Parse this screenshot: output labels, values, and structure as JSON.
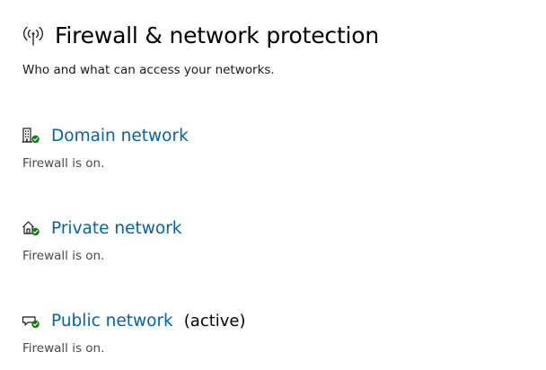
{
  "header": {
    "icon": "wireless-signal-icon",
    "title": "Firewall & network protection",
    "subtitle": "Who and what can access your networks."
  },
  "networks": [
    {
      "icon": "domain-network-icon",
      "name": "Domain network",
      "active_label": "",
      "status": "Firewall is on."
    },
    {
      "icon": "private-network-icon",
      "name": "Private network",
      "active_label": "",
      "status": "Firewall is on."
    },
    {
      "icon": "public-network-icon",
      "name": "Public network",
      "active_label": "(active)",
      "status": "Firewall is on."
    }
  ],
  "colors": {
    "link": "#0063b1",
    "check_badge": "#107c10",
    "status_text": "#4a4a4a"
  }
}
